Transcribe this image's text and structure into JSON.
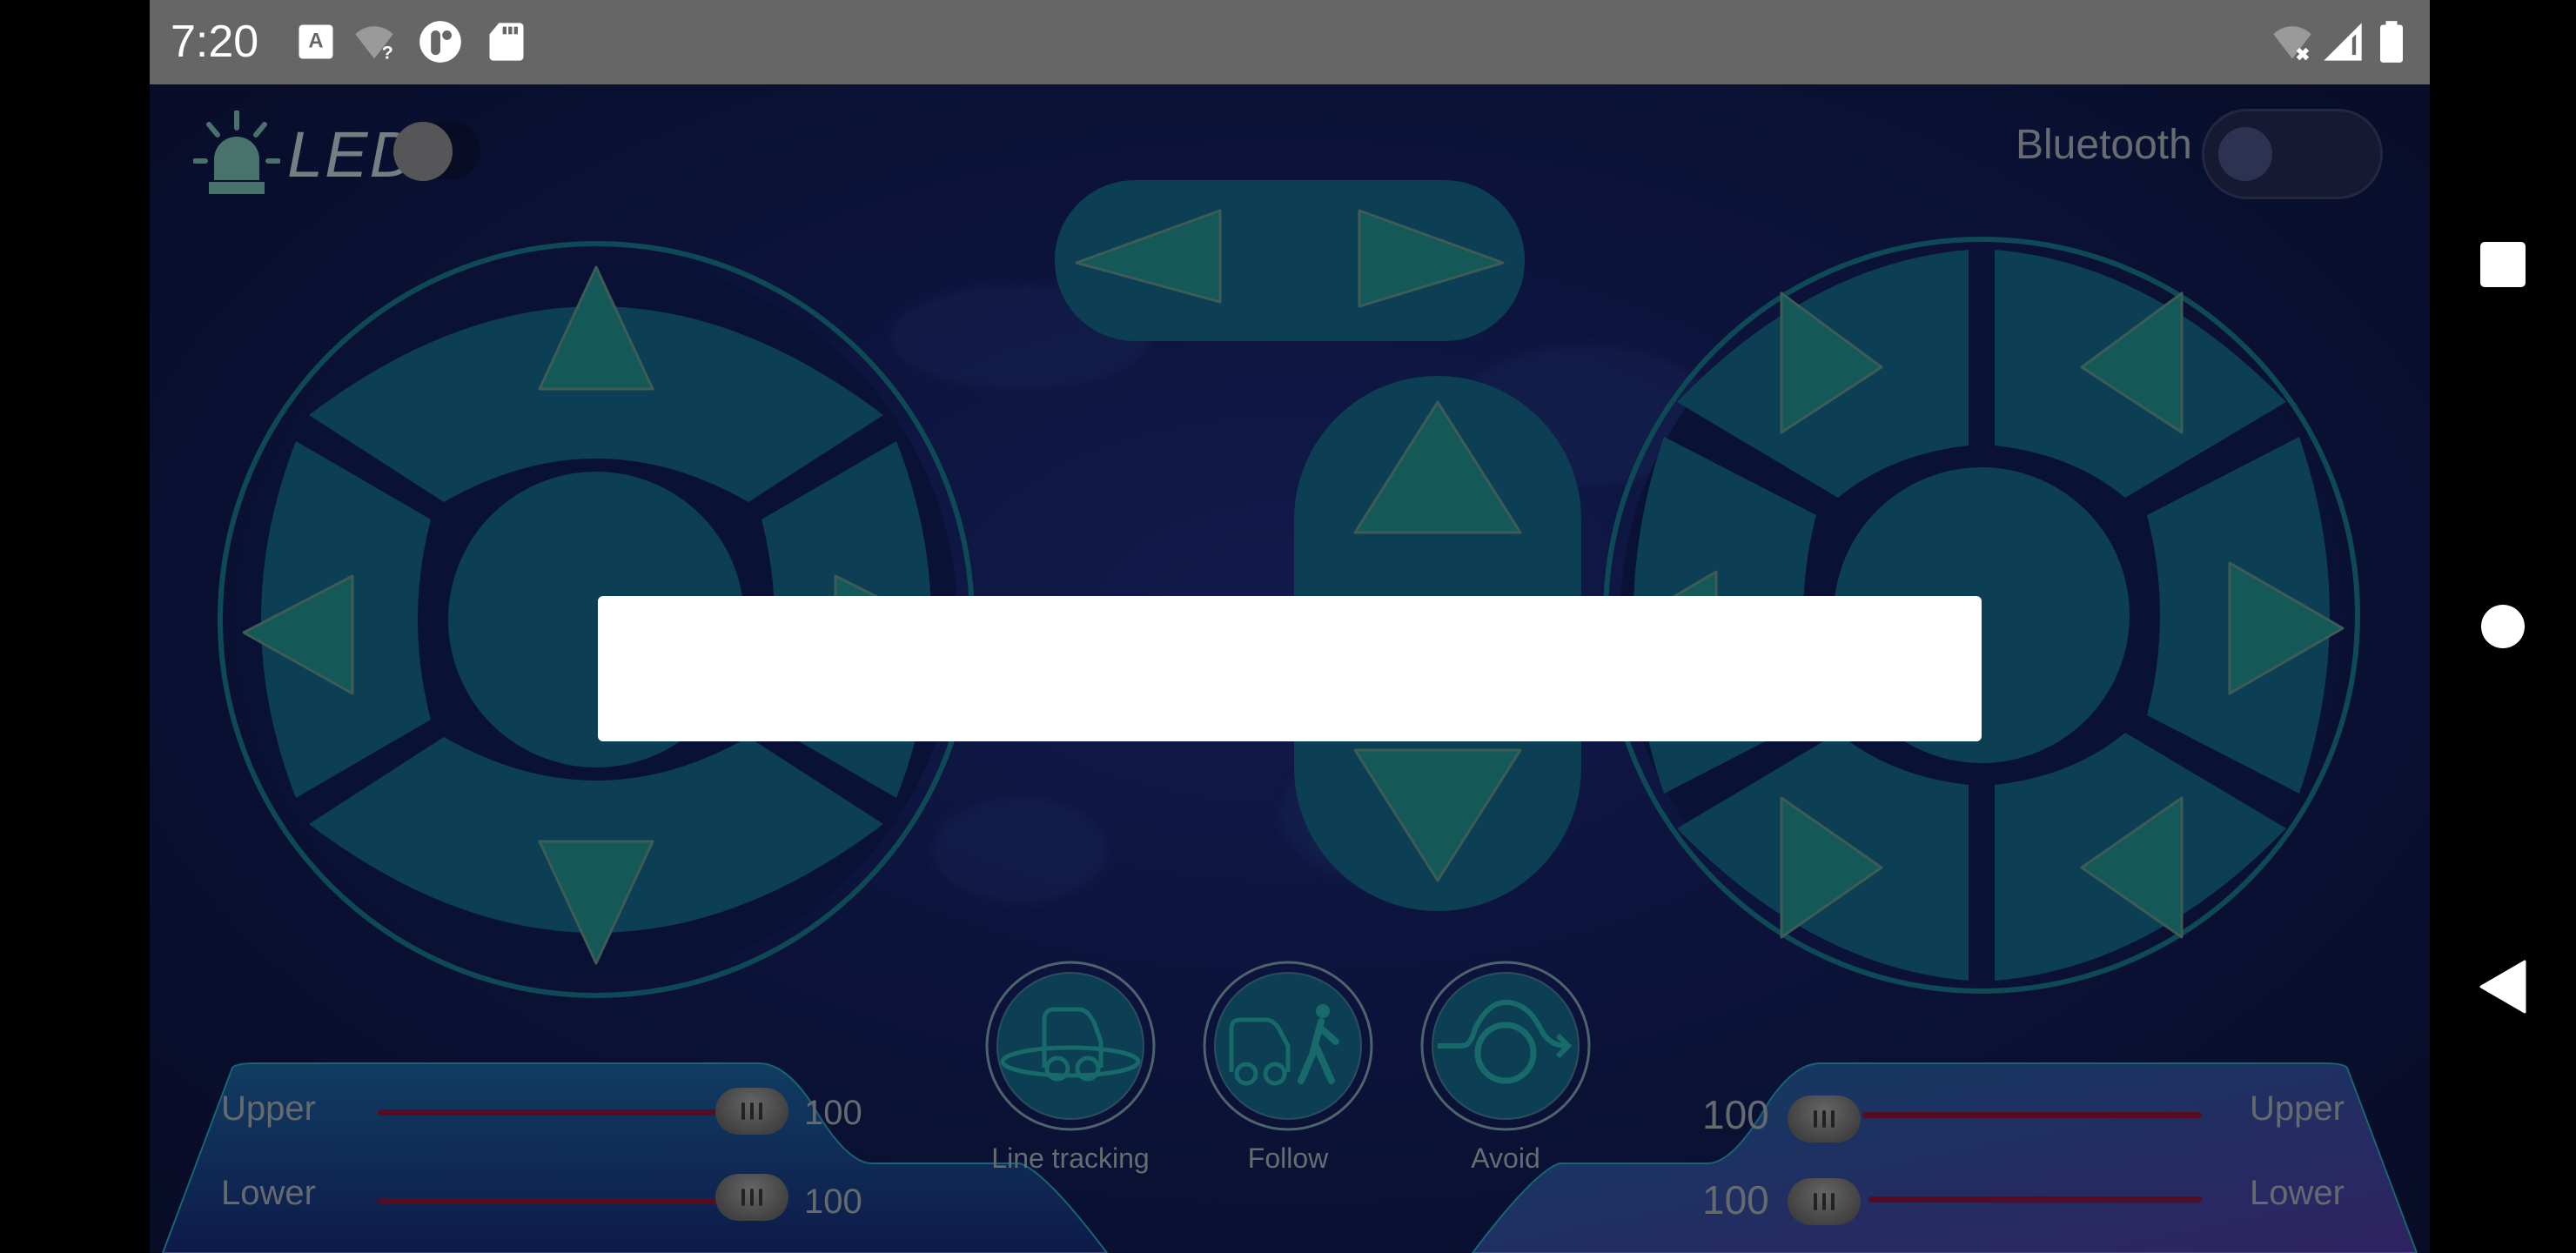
{
  "status_bar": {
    "time": "7:20",
    "left_icons": [
      "text-input-icon",
      "wifi-unknown-icon",
      "app-notification-icon",
      "sd-card-icon"
    ],
    "right_icons": [
      "wifi-off-icon",
      "cellular-signal-icon",
      "battery-icon"
    ]
  },
  "nav_bar": {
    "buttons": [
      "recents",
      "home",
      "back"
    ]
  },
  "app": {
    "led": {
      "label": "LED",
      "state": "off"
    },
    "bluetooth": {
      "label": "Bluetooth",
      "state": "off"
    },
    "left_pad": {
      "buttons": [
        "up",
        "left",
        "right",
        "down",
        "center"
      ]
    },
    "center_controls": {
      "horizontal": [
        "rotate-left",
        "rotate-right"
      ],
      "vertical": [
        "forward",
        "stop",
        "backward"
      ]
    },
    "right_pad": {
      "buttons": [
        "up-left",
        "up-right",
        "left",
        "right",
        "down-left",
        "down-right",
        "center"
      ]
    },
    "modes": [
      {
        "label": "Line tracking",
        "icon": "line-tracking-icon"
      },
      {
        "label": "Follow",
        "icon": "follow-icon"
      },
      {
        "label": "Avoid",
        "icon": "avoid-icon"
      }
    ],
    "left_speed": {
      "upper": {
        "label": "Upper",
        "value": "100",
        "fraction": 1.0
      },
      "lower": {
        "label": "Lower",
        "value": "100",
        "fraction": 1.0
      }
    },
    "right_speed": {
      "upper": {
        "label": "Upper",
        "value": "100",
        "fraction": 1.0
      },
      "lower": {
        "label": "Lower",
        "value": "100",
        "fraction": 1.0
      }
    },
    "dialog": {
      "text": ""
    }
  },
  "colors": {
    "background": "#0f1848",
    "pad_segment": "#0f4d66",
    "arrow": "#1a6c6c",
    "slider_track": "#6a0f2a",
    "status_bar": "#666666"
  }
}
